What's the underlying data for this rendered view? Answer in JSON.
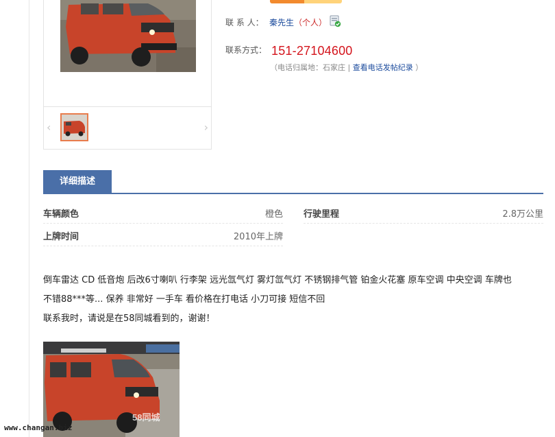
{
  "contact": {
    "person_label": "联 系 人：",
    "name": "秦先生",
    "type": "（个人）",
    "method_label": "联系方式：",
    "phone": "151-27104600",
    "location_prefix": "（电话归属地：石家庄 |",
    "history_link": "查看电话发帖纪录",
    "location_suffix": "）"
  },
  "gallery": {
    "prev_glyph": "‹",
    "next_glyph": "›"
  },
  "detail": {
    "tab_label": "详细描述",
    "rows": [
      {
        "key": "车辆颜色",
        "value": "橙色"
      },
      {
        "key": "行驶里程",
        "value": "2.8万公里"
      },
      {
        "key": "上牌时间",
        "value": "2010年上牌"
      }
    ],
    "description_lines": [
      "倒车雷达 CD 低音炮 后改6寸喇叭 行李架 远光氙气灯 雾灯氙气灯 不锈钢排气管 铂金火花塞 原车空调 中央空调 车牌也",
      "不错88***等... 保养 非常好 一手车 看价格在打电话 小刀可接 短信不回",
      "联系我时，请说是在58同城看到的，谢谢！"
    ]
  },
  "photo_watermark": "58同城",
  "site_watermark": "www.changan.biz",
  "colors": {
    "accent_blue": "#4a6fa8",
    "phone_red": "#d4141c",
    "van_red": "#c8442a"
  }
}
